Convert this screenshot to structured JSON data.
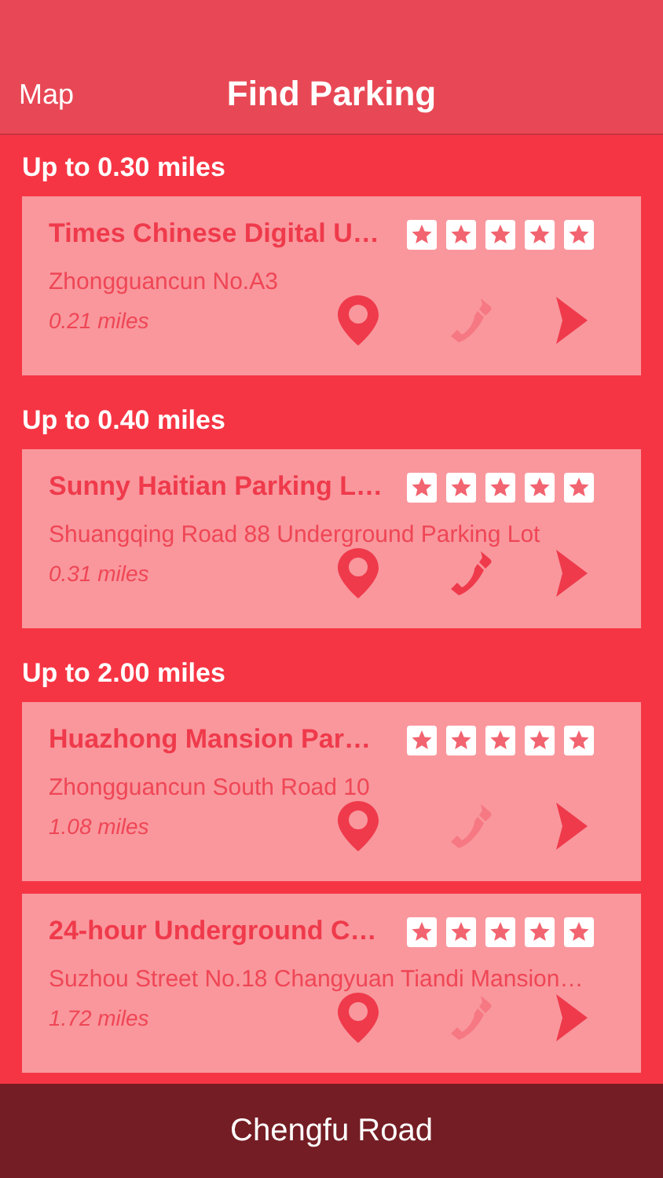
{
  "nav_bar": {
    "left_button": "Map",
    "title": "Find Parking"
  },
  "sections": [
    {
      "header": "Up to 0.30 miles",
      "items": [
        {
          "name": "Times Chinese Digital U…",
          "stars": 5,
          "address": "Zhongguancun No.A3",
          "distance": "0.21 miles",
          "phone_available": false
        }
      ]
    },
    {
      "header": "Up to 0.40 miles",
      "items": [
        {
          "name": "Sunny Haitian Parking L…",
          "stars": 5,
          "address": "Shuangqing Road 88 Underground Parking Lot",
          "distance": "0.31 miles",
          "phone_available": true
        }
      ]
    },
    {
      "header": "Up to 2.00 miles",
      "items": [
        {
          "name": "Huazhong Mansion Par…",
          "stars": 5,
          "address": "Zhongguancun South Road 10",
          "distance": "1.08 miles",
          "phone_available": false
        },
        {
          "name": "24-hour Underground C…",
          "stars": 5,
          "address": "Suzhou Street No.18 Changyuan Tiandi Mansion…",
          "distance": "1.72 miles",
          "phone_available": false
        }
      ]
    }
  ],
  "bottom_bar": {
    "label": "Chengfu Road"
  }
}
